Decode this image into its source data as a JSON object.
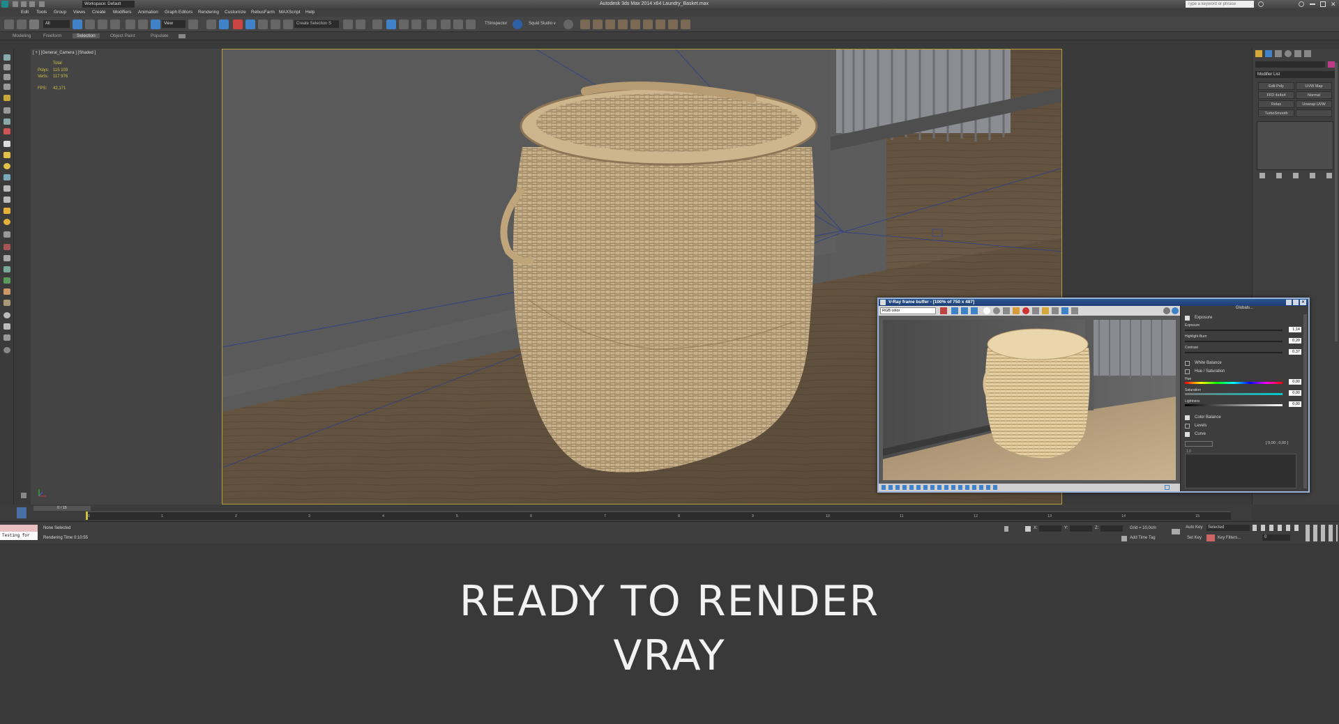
{
  "window": {
    "title": "Autodesk 3ds Max  2014 x64    Laundry_Basket.max",
    "workspace_label": "Workspace: Default",
    "search_placeholder": "Type a keyword or phrase"
  },
  "menu": [
    "Edit",
    "Tools",
    "Group",
    "Views",
    "Create",
    "Modifiers",
    "Animation",
    "Graph Editors",
    "Rendering",
    "Customize",
    "RebusFarm",
    "MAXScript",
    "Help"
  ],
  "toolbar": {
    "selection_filter": "All",
    "view_label": "View",
    "selection_set_placeholder": "Create Selection S",
    "ts_inspector": "TSInspector",
    "squid_studio": "Squid Studio v"
  },
  "ribbon": {
    "tabs": [
      "Modeling",
      "Freeform",
      "Selection",
      "Object Paint",
      "Populate"
    ],
    "active_tab": "Selection"
  },
  "viewport": {
    "label": "[ + ] [General_Camera ] [Shaded ]",
    "stats": {
      "total_label": "Total",
      "polys_label": "Polys:",
      "polys_value": "115 103",
      "verts_label": "Verts:",
      "verts_value": "117 976",
      "fps_label": "FPS:",
      "fps_value": "42,171"
    }
  },
  "command_panel": {
    "modifier_list": "Modifier List",
    "buttons": [
      "Edit Poly",
      "UVW Map",
      "FFD 4x4x4",
      "Normal",
      "Relax",
      "Unwrap UVW",
      "TurboSmooth"
    ]
  },
  "vfb": {
    "title": "V-Ray frame buffer - [100% of 750 x 487]",
    "channel": "RGB color",
    "globals": "Globals...",
    "sections": {
      "exposure": "Exposure",
      "white_balance": "White Balance",
      "hue_saturation": "Hue / Saturation",
      "color_balance": "Color Balance",
      "levels": "Levels",
      "curve": "Curve"
    },
    "sliders": {
      "exposure_label": "Exposure",
      "exposure_value": "1,14",
      "highlight_label": "Highlight Burn",
      "highlight_value": "0,20",
      "contrast_label": "Contrast",
      "contrast_value": "0,37",
      "hue_label": "Hue",
      "hue_value": "0,00",
      "saturation_label": "Saturation",
      "saturation_value": "0,00",
      "lightness_label": "Lightness",
      "lightness_value": "0,00"
    },
    "curve_coords": "[ 0,00 ; 0,00 ]",
    "curve_value": "1,0"
  },
  "timeline": {
    "frame_counter": "0 / 15",
    "ticks": [
      "0",
      "1",
      "2",
      "3",
      "4",
      "5",
      "6",
      "7",
      "8",
      "9",
      "10",
      "11",
      "12",
      "13",
      "14",
      "15"
    ]
  },
  "status": {
    "script_field": "Testing for",
    "selection": "None Selected",
    "render_time": "Rendering Time  0:10:55",
    "x_label": "X:",
    "y_label": "Y:",
    "z_label": "Z:",
    "grid": "Grid = 10,0cm",
    "add_time_tag": "Add Time Tag",
    "auto_key": "Auto Key",
    "set_key": "Set Key",
    "selected": "Selected",
    "key_filters": "Key Filters...",
    "frame": "0"
  },
  "caption": {
    "line1": "READY TO RENDER",
    "line2": "VRAY"
  },
  "colors": {
    "accent_blue": "#2a5590",
    "viewport_border": "#b89c3a",
    "stats_yellow": "#d2c447"
  }
}
